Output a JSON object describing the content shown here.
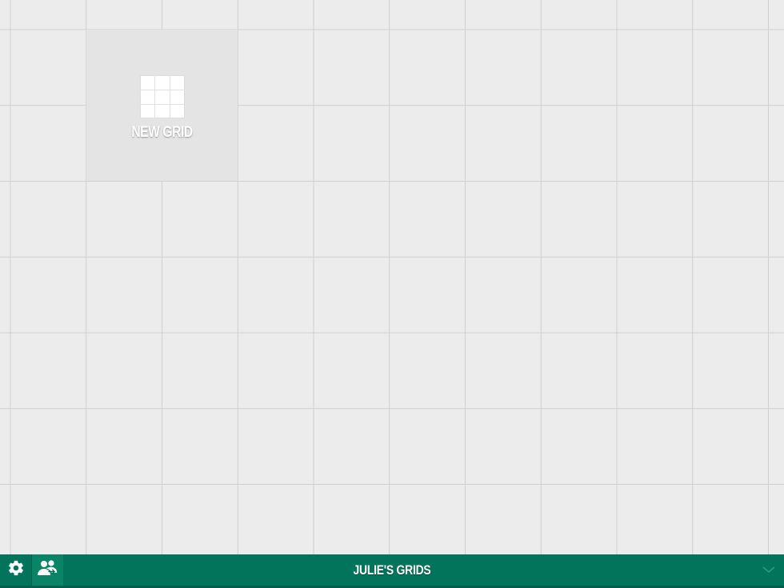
{
  "workspace": {
    "new_grid_label": "NEW GRID"
  },
  "bottom_bar": {
    "title": "JULIE'S GRIDS",
    "settings_icon": "gear-icon",
    "share_icon": "people-share-icon",
    "menu_icon": "chevron-down-icon",
    "background_color": "#02745b"
  }
}
